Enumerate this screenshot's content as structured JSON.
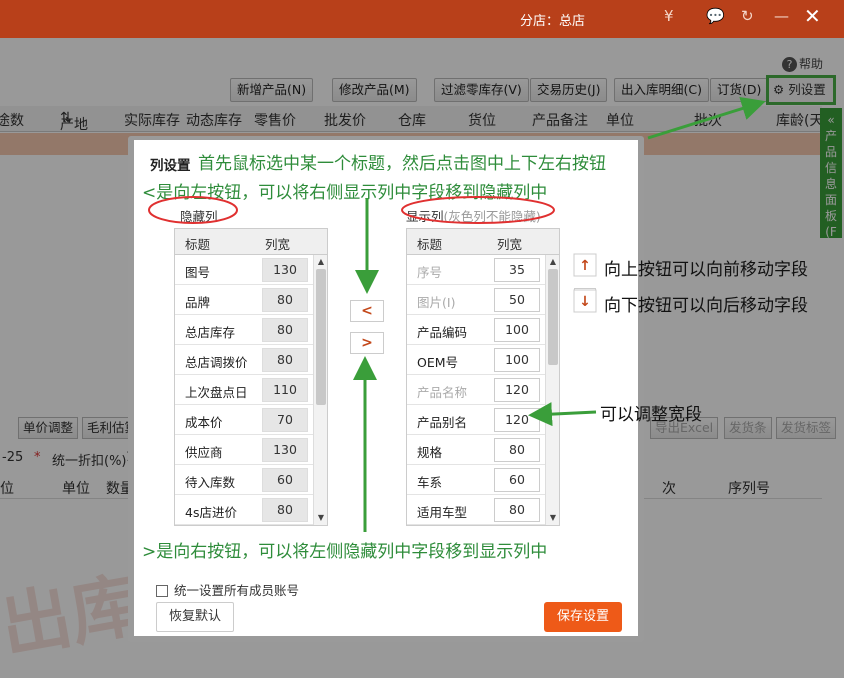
{
  "titlebar": {
    "branch": "分店：总店",
    "yen_icon": "yen-icon",
    "chat_icon": "chat-icon",
    "refresh_icon": "refresh-icon",
    "minimize_icon": "minimize-icon",
    "close_icon": "close-icon",
    "yen": "¥",
    "close": "✕"
  },
  "help": {
    "label": "帮助",
    "q": "?"
  },
  "toolbar": {
    "buttons": [
      "新增产品(N)",
      "修改产品(M)",
      "过滤零库存(V)",
      "交易历史(J)",
      "出入库明细(C)",
      "订货(D)"
    ],
    "colset": "列设置"
  },
  "grid_header": [
    "途数",
    "产地",
    "实际库存",
    "动态库存",
    "零售价",
    "批发价",
    "仓库",
    "货位",
    "产品备注",
    "单位",
    "批次",
    "库龄(天"
  ],
  "side_panel": "产品信息面板(F4)",
  "lower": {
    "buttons": [
      "单价调整",
      "毛利估算",
      "导出Excel",
      "发货条",
      "发货标签"
    ],
    "date": "-25",
    "discount_star": "*",
    "discount": "统一折扣(%)",
    "discount_value": "1",
    "grid_header": [
      "位",
      "单位",
      "数量",
      "次",
      "序列号"
    ],
    "watermark": "出库"
  },
  "dialog": {
    "title": "列设置",
    "hidden_label": "隐藏列",
    "shown_label": "显示列",
    "shown_note": "(灰色列不能隐藏)",
    "col_title": "标题",
    "col_width": "列宽",
    "hidden_rows": [
      {
        "name": "图号",
        "width": "130"
      },
      {
        "name": "品牌",
        "width": "80"
      },
      {
        "name": "总店库存",
        "width": "80"
      },
      {
        "name": "总店调拨价",
        "width": "80"
      },
      {
        "name": "上次盘点日",
        "width": "110"
      },
      {
        "name": "成本价",
        "width": "70"
      },
      {
        "name": "供应商",
        "width": "130"
      },
      {
        "name": "待入库数",
        "width": "60"
      },
      {
        "name": "4s店进价",
        "width": "80"
      }
    ],
    "shown_rows": [
      {
        "name": "序号",
        "width": "35",
        "locked": true
      },
      {
        "name": "图片(I)",
        "width": "50",
        "locked": true
      },
      {
        "name": "产品编码",
        "width": "100",
        "locked": false
      },
      {
        "name": "OEM号",
        "width": "100",
        "locked": false
      },
      {
        "name": "产品名称",
        "width": "120",
        "locked": true
      },
      {
        "name": "产品别名",
        "width": "120",
        "locked": false
      },
      {
        "name": "规格",
        "width": "80",
        "locked": false
      },
      {
        "name": "车系",
        "width": "60",
        "locked": false
      },
      {
        "name": "适用车型",
        "width": "80",
        "locked": false
      }
    ],
    "move_left": "<",
    "move_right": ">",
    "move_up": "↑",
    "move_down": "↓",
    "sync_all": "统一设置所有成员账号",
    "reset": "恢复默认",
    "save": "保存设置"
  },
  "annotations": {
    "step1": "首先鼠标选中某一个标题，然后点击图中上下左右按钮",
    "left_btn": "<是向左按钮，可以将右侧显示列中字段移到隐藏列中",
    "right_btn": ">是向右按钮，可以将左侧隐藏列中字段移到显示列中",
    "up": "向上按钮可以向前移动字段",
    "down": "向下按钮可以向后移动字段",
    "width": "可以调整宽段"
  },
  "colors": {
    "accent": "#ee5a18",
    "annotation": "#2e8c3a",
    "highlight": "#4ab046",
    "circle": "#e03030"
  }
}
